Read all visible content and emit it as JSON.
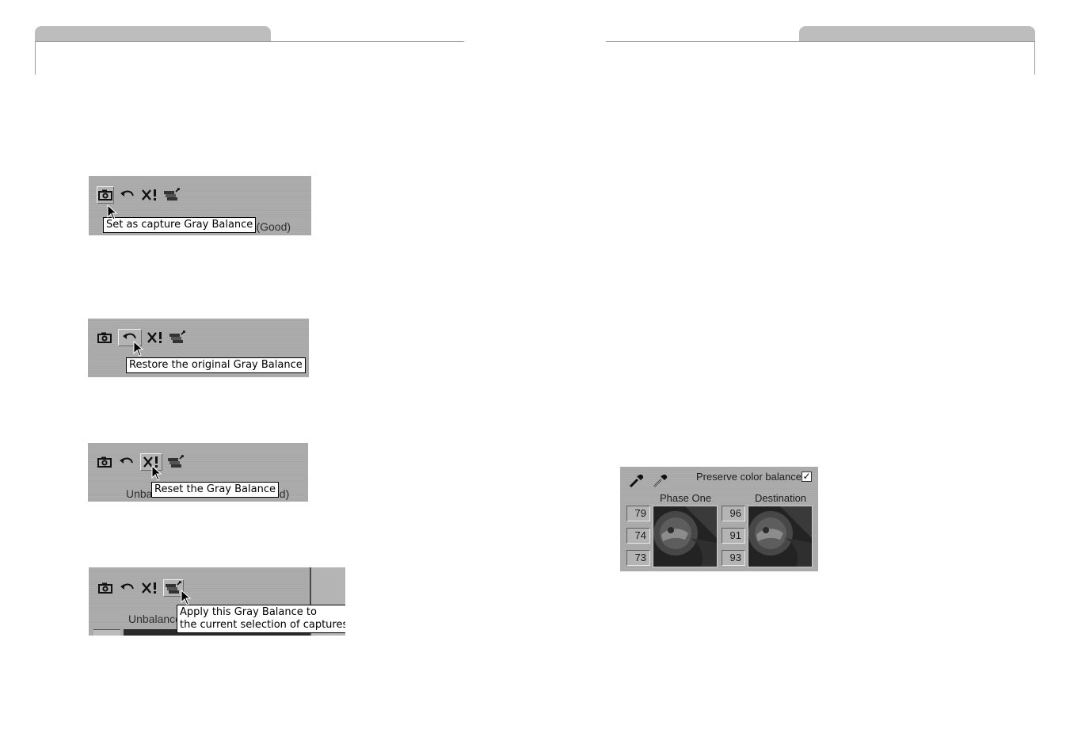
{
  "screenshots": [
    {
      "tooltip": "Set as capture Gray Balance",
      "underlying_text": "ed (Good)"
    },
    {
      "tooltip": "Restore the original Gray Balance",
      "underlying_text": ""
    },
    {
      "tooltip": "Reset the Gray Balance",
      "underlying_text_left": "Unba",
      "underlying_text_right": "od)"
    },
    {
      "tooltip_line1": "Apply this Gray Balance to",
      "tooltip_line2": "the current selection of captures",
      "underlying_text": "Unbalance"
    }
  ],
  "toolbar_icons": [
    "camera-icon",
    "undo-icon",
    "reset-icon",
    "apply-to-selection-icon"
  ],
  "gray_balance": {
    "preserve_label": "Preserve color balance",
    "preserve_checked": true,
    "check_mark": "✓",
    "phase_one_label": "Phase One",
    "destination_label": "Destination",
    "phase_one_values": [
      "79",
      "74",
      "73"
    ],
    "destination_values": [
      "96",
      "91",
      "93"
    ]
  }
}
